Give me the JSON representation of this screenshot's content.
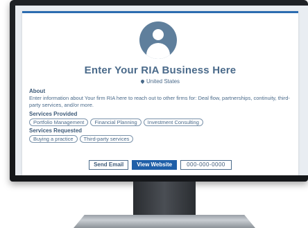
{
  "profile": {
    "title": "Enter Your RIA Business Here",
    "location": "United States"
  },
  "about": {
    "label": "About",
    "text": "Enter information about Your firm RIA here to reach out to other firms for: Deal flow, partnerships, continuity, third-party services, and/or more."
  },
  "services_provided": {
    "label": "Services Provided",
    "tags": [
      "Portfolio Management",
      "Financial Planning",
      "Investment Consulting"
    ]
  },
  "services_requested": {
    "label": "Services Requested",
    "tags": [
      "Buying a practice",
      "Third-party services"
    ]
  },
  "actions": {
    "send_email": "Send Email",
    "view_website": "View Website",
    "phone": "000-000-0000"
  },
  "colors": {
    "accent": "#1f5fa8",
    "text": "#4a6a8a",
    "avatar": "#5f7f9c"
  },
  "icons": {
    "location": "map-pin-icon",
    "avatar": "user-avatar-icon"
  }
}
